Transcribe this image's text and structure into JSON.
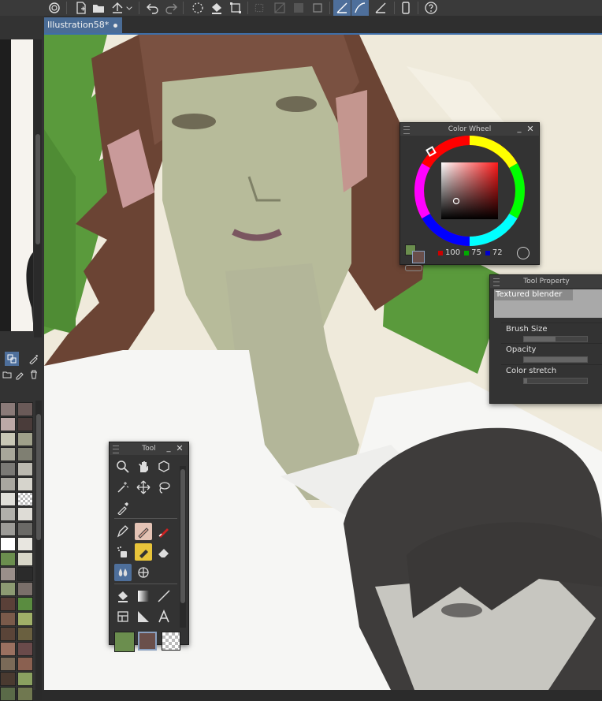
{
  "document": {
    "tab_title": "Illustration58*"
  },
  "toolbar": {
    "icons": [
      "app-icon",
      "new-icon",
      "open-icon",
      "save-icon",
      "dropdown-icon",
      "undo-icon",
      "redo-icon",
      "transform-icon",
      "fill-icon",
      "select-icon",
      "clear-icon",
      "invert-icon",
      "frame-icon",
      "ruler-snap-icon",
      "curve-snap-icon",
      "guide-icon",
      "phone-icon",
      "help-icon"
    ]
  },
  "color_wheel_panel": {
    "title": "Color Wheel",
    "red": "100",
    "green": "75",
    "blue": "72",
    "main_color": "#6b8e4e",
    "sub_color": "#6a4f4b"
  },
  "tool_property_panel": {
    "title": "Tool Property",
    "tool_name": "Textured blender",
    "brush_size_label": "Brush Size",
    "opacity_label": "Opacity",
    "color_stretch_label": "Color stretch",
    "brush_size_level": 0.5,
    "opacity_level": 1.0,
    "color_stretch_level": 0.05
  },
  "tool_panel": {
    "title": "Tool",
    "tools": [
      "zoom-icon",
      "hand-icon",
      "rotate-3d-icon",
      "magic-wand-icon",
      "move-icon",
      "lasso-icon",
      "eyedropper-icon",
      "pen-icon",
      "eraser-pencil-icon",
      "correction-pen-icon",
      "airbrush-icon",
      "marker-icon",
      "eraser-icon",
      "blend-icon",
      "grid-icon",
      "fill-bucket-icon",
      "gradient-icon",
      "line-icon",
      "frame-icon",
      "ruler-icon",
      "text-icon"
    ],
    "main_color": "#6b8e4e",
    "sub_color": "#6a4f4b"
  },
  "colors": {
    "accent": "#4e6f9b",
    "panel": "#333333",
    "canvas_bg": "#efeadb",
    "leaves": "#5a9a3c",
    "hair": "#6b4434",
    "skin": "#b7bb9a",
    "shirt": "#f6f6f4",
    "dark_hair": "#3e3c3b"
  }
}
